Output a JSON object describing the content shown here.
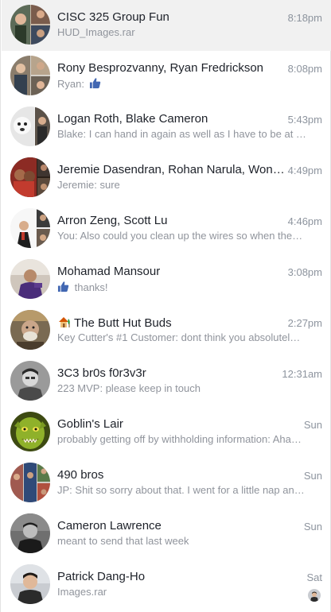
{
  "conversations": [
    {
      "name": "CISC 325 Group Fun",
      "time": "8:18pm",
      "snippet": "HUD_Images.rar",
      "selected": true,
      "avatar": "group-avatar-1"
    },
    {
      "name": "Rony Besprozvanny, Ryan Fredrickson",
      "time": "8:08pm",
      "snippet": "Ryan:",
      "like": true,
      "avatar": "group-avatar-2"
    },
    {
      "name": "Logan Roth, Blake Cameron",
      "time": "5:43pm",
      "snippet": "Blake: I can hand in again as well as I have to be at …",
      "avatar": "group-avatar-3"
    },
    {
      "name": "Jeremie Dasendran, Rohan Narula, WonJ…",
      "time": "4:49pm",
      "snippet": "Jeremie: sure",
      "avatar": "group-avatar-4"
    },
    {
      "name": "Arron Zeng, Scott Lu",
      "time": "4:46pm",
      "snippet": "You: Also could you clean up the wires so when the…",
      "avatar": "group-avatar-5"
    },
    {
      "name": "Mohamad Mansour",
      "time": "3:08pm",
      "snippet": "thanks!",
      "like_before": true,
      "avatar": "person-avatar"
    },
    {
      "name": "The Butt Hut Buds",
      "time": "2:27pm",
      "snippet": "Key Cutter's #1 Customer: dont think you absolutel…",
      "emoji": "house-icon",
      "avatar": "group-avatar-6"
    },
    {
      "name": "3C3 br0s f0r3v3r",
      "time": "12:31am",
      "snippet": "223 MVP: please keep in touch",
      "avatar": "person-avatar"
    },
    {
      "name": "Goblin's Lair",
      "time": "Sun",
      "snippet": "probably getting off by withholding information: Aha…",
      "avatar": "goblin-avatar"
    },
    {
      "name": "490 bros",
      "time": "Sun",
      "snippet": "JP: Shit so sorry about that. I went for a little nap an…",
      "avatar": "group-avatar-7"
    },
    {
      "name": "Cameron Lawrence",
      "time": "Sun",
      "snippet": "meant to send that last week",
      "avatar": "person-avatar"
    },
    {
      "name": "Patrick Dang-Ho",
      "time": "Sat",
      "snippet": "Images.rar",
      "seen": true,
      "avatar": "person-avatar"
    }
  ],
  "colors": {
    "accent": "#4267b2",
    "name": "#1d2129",
    "meta": "#90949c",
    "selected_bg": "#f1f1f1"
  }
}
